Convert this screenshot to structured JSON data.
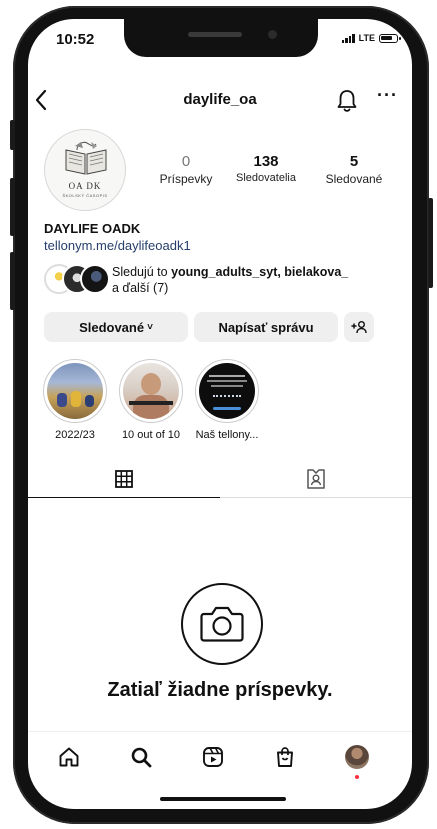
{
  "status_bar": {
    "time": "10:52",
    "network": "LTE"
  },
  "header": {
    "username": "daylife_oa",
    "back_icon": "chevron-left-icon",
    "bell_icon": "bell-icon",
    "more_icon": "more-horizontal-icon",
    "more_glyph": "···",
    "back_glyph": "<"
  },
  "profile": {
    "avatar": {
      "line1": "OA DK",
      "line2": "ŠKOLSKÝ ČASOPIS"
    },
    "stats": [
      {
        "value": "0",
        "label": "Príspevky"
      },
      {
        "value": "138",
        "label": "Sledovatelia"
      },
      {
        "value": "5",
        "label": "Sledované"
      }
    ],
    "display_name": "DAYLIFE OADK",
    "link": "tellonym.me/daylifeoadk1",
    "followed_by": {
      "prefix": "Sledujú to ",
      "names": "young_adults_syt, bielakova_",
      "suffix": "a ďalší (7)"
    }
  },
  "actions": {
    "following": "Sledované",
    "following_chevron": "˅",
    "message": "Napísať správu",
    "add_user_glyph": "+♀"
  },
  "highlights": [
    {
      "label": "2022/23"
    },
    {
      "label": "10 out of 10"
    },
    {
      "label": "Naš tellony..."
    }
  ],
  "tabs": [
    {
      "name": "grid",
      "icon": "grid-icon",
      "active": true
    },
    {
      "name": "tagged",
      "icon": "tagged-user-icon",
      "active": false
    }
  ],
  "empty_state": {
    "icon": "camera-icon",
    "text": "Zatiaľ žiadne príspevky."
  },
  "bottom_nav": [
    {
      "icon": "home-icon"
    },
    {
      "icon": "search-icon"
    },
    {
      "icon": "reels-icon"
    },
    {
      "icon": "shop-icon"
    },
    {
      "icon": "profile-avatar-icon"
    }
  ],
  "colors": {
    "link": "#27406b",
    "button_bg": "#efefef",
    "notification_dot": "#ff3040"
  }
}
